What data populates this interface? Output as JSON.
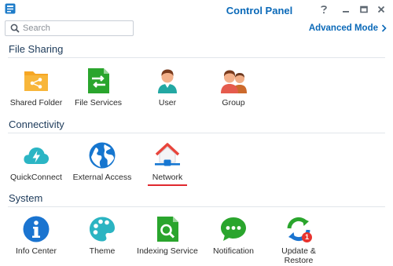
{
  "window": {
    "title": "Control Panel"
  },
  "search": {
    "placeholder": "Search"
  },
  "header": {
    "advanced_mode_label": "Advanced Mode"
  },
  "sections": {
    "file_sharing": {
      "title": "File Sharing",
      "items": [
        {
          "label": "Shared Folder",
          "icon": "shared-folder-icon"
        },
        {
          "label": "File Services",
          "icon": "file-services-icon"
        },
        {
          "label": "User",
          "icon": "user-icon"
        },
        {
          "label": "Group",
          "icon": "group-icon"
        }
      ]
    },
    "connectivity": {
      "title": "Connectivity",
      "items": [
        {
          "label": "QuickConnect",
          "icon": "quickconnect-icon"
        },
        {
          "label": "External Access",
          "icon": "external-access-icon"
        },
        {
          "label": "Network",
          "icon": "network-icon",
          "selected": true
        }
      ]
    },
    "system": {
      "title": "System",
      "items": [
        {
          "label": "Info Center",
          "icon": "info-center-icon"
        },
        {
          "label": "Theme",
          "icon": "theme-icon"
        },
        {
          "label": "Indexing Service",
          "icon": "indexing-service-icon"
        },
        {
          "label": "Notification",
          "icon": "notification-icon"
        },
        {
          "label": "Update & Restore",
          "icon": "update-restore-icon",
          "badge": "1"
        }
      ]
    }
  },
  "colors": {
    "accent": "#0a69b8",
    "selected_underline": "#e0282e"
  }
}
